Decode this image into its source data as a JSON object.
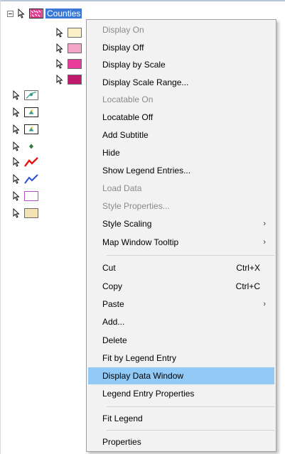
{
  "tree": {
    "top_layer": "Counties",
    "colors": {
      "selection": "#3a78d8",
      "sym_pink_pattern": "#e04090",
      "sym_yellow": "#fbf1c8",
      "sym_pink": "#f3a6c8",
      "sym_magenta": "#e83e9a",
      "sym_dark_magenta": "#c0196e",
      "sym_teal": "#2a9d8f",
      "sym_dot": "#2f7d3a",
      "sym_red": "#e01616",
      "sym_blue": "#2c4fcf",
      "sym_purple": "#b44fc8",
      "sym_tan": "#f3e2b3"
    }
  },
  "menu": {
    "items": [
      {
        "label": "Display On",
        "disabled": true
      },
      {
        "label": "Display Off"
      },
      {
        "label": "Display by Scale"
      },
      {
        "label": "Display Scale Range..."
      },
      {
        "label": "Locatable On",
        "disabled": true
      },
      {
        "label": "Locatable Off"
      },
      {
        "label": "Add Subtitle"
      },
      {
        "label": "Hide"
      },
      {
        "label": "Show Legend Entries..."
      },
      {
        "label": "Load Data",
        "disabled": true
      },
      {
        "label": "Style Properties...",
        "disabled": true
      },
      {
        "label": "Style Scaling",
        "submenu": true
      },
      {
        "label": "Map Window Tooltip",
        "submenu": true
      },
      {
        "label": "Cut",
        "shortcut": "Ctrl+X"
      },
      {
        "label": "Copy",
        "shortcut": "Ctrl+C"
      },
      {
        "label": "Paste",
        "submenu": true
      },
      {
        "label": "Add..."
      },
      {
        "label": "Delete"
      },
      {
        "label": "Fit by Legend Entry"
      },
      {
        "label": "Display Data Window",
        "highlighted": true
      },
      {
        "label": "Legend Entry Properties"
      },
      {
        "label": "Fit Legend"
      },
      {
        "label": "Properties"
      }
    ],
    "colors": {
      "background": "#f2f2f2",
      "highlight": "#91c9f7",
      "disabled_text": "#8a8a8a"
    }
  }
}
